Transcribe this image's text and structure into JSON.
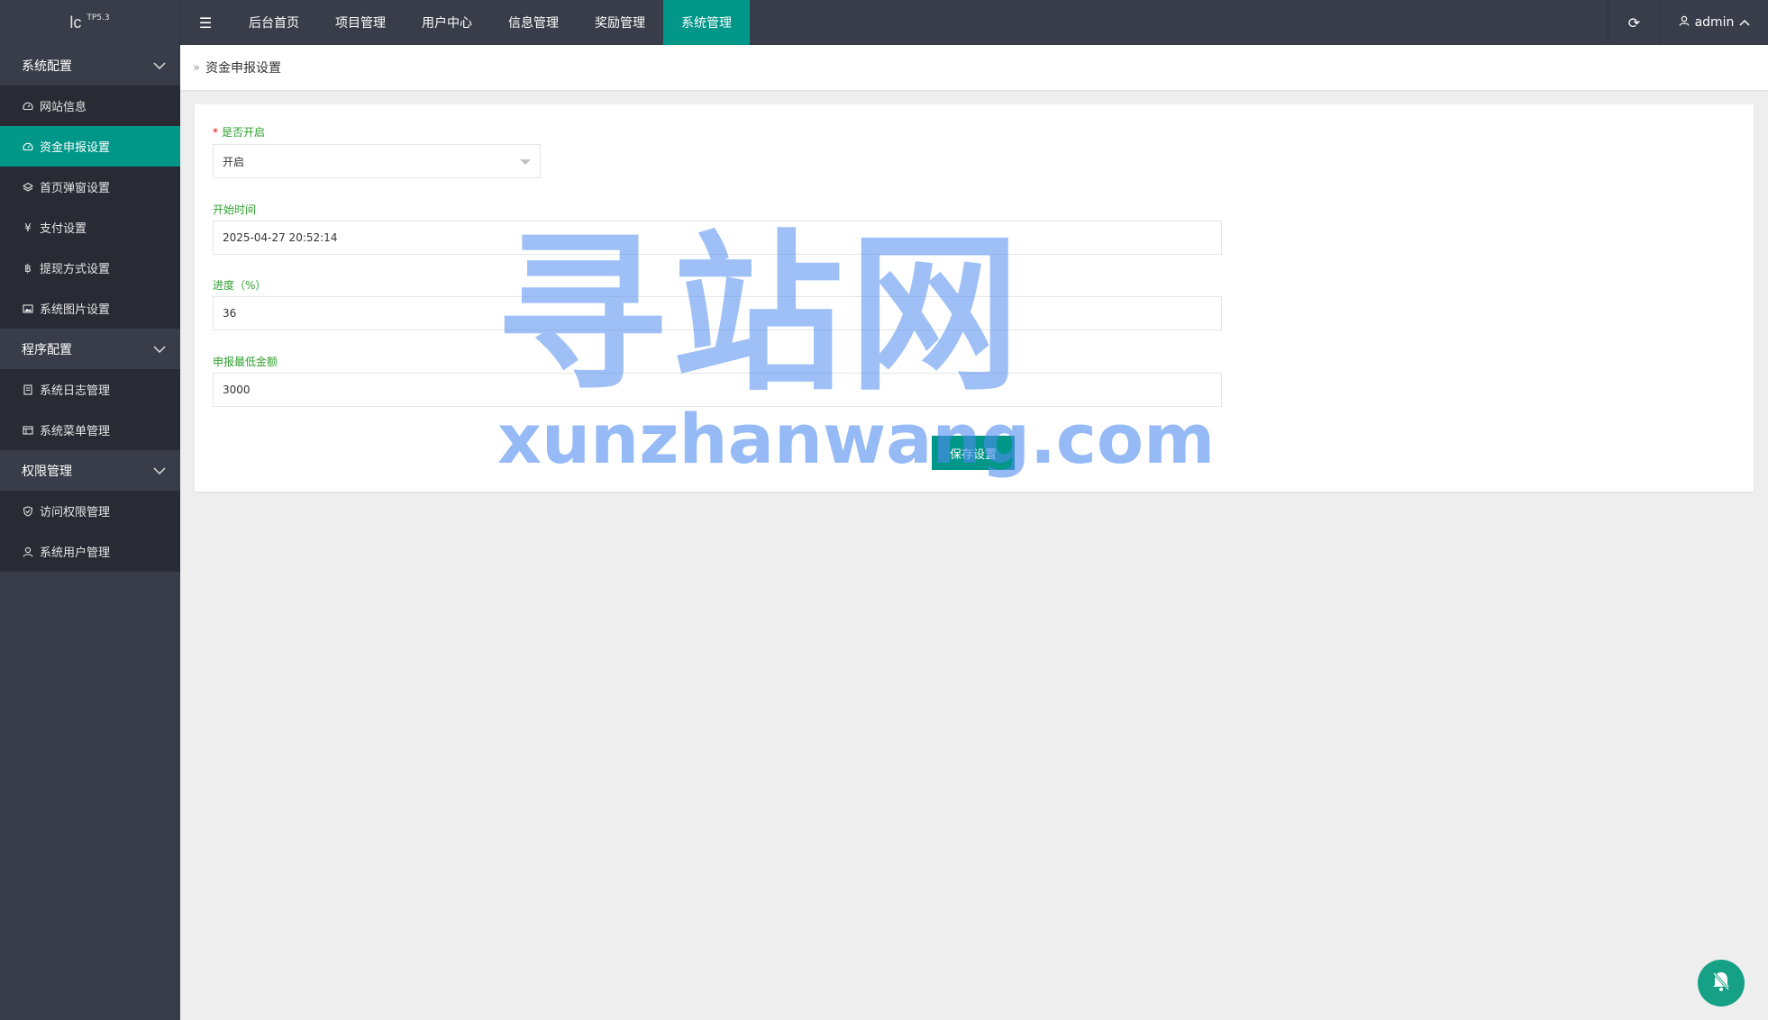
{
  "logo": {
    "main": "lc",
    "sup": "TP5.3"
  },
  "topnav": {
    "toggle_icon": "menu-icon",
    "items": [
      "后台首页",
      "项目管理",
      "用户中心",
      "信息管理",
      "奖励管理",
      "系统管理"
    ],
    "active_index": 5
  },
  "user": {
    "name": "admin"
  },
  "sidebar": {
    "groups": [
      {
        "label": "系统配置",
        "items": [
          {
            "label": "网站信息",
            "icon": "dashboard-icon"
          },
          {
            "label": "资金申报设置",
            "icon": "dashboard-icon",
            "active": true
          },
          {
            "label": "首页弹窗设置",
            "icon": "layers-icon"
          },
          {
            "label": "支付设置",
            "icon": "yen-icon"
          },
          {
            "label": "提现方式设置",
            "icon": "bitcoin-icon"
          },
          {
            "label": "系统图片设置",
            "icon": "image-icon"
          }
        ]
      },
      {
        "label": "程序配置",
        "items": [
          {
            "label": "系统日志管理",
            "icon": "log-icon"
          },
          {
            "label": "系统菜单管理",
            "icon": "menu-table-icon"
          }
        ]
      },
      {
        "label": "权限管理",
        "items": [
          {
            "label": "访问权限管理",
            "icon": "shield-icon"
          },
          {
            "label": "系统用户管理",
            "icon": "user-icon"
          }
        ]
      }
    ]
  },
  "breadcrumb": {
    "current": "资金申报设置"
  },
  "form": {
    "enabled": {
      "label": "是否开启",
      "required": "*",
      "value": "开启"
    },
    "start_time": {
      "label": "开始时间",
      "value": "2025-04-27 20:52:14"
    },
    "progress": {
      "label": "进度（%）",
      "value": "36"
    },
    "min_amount": {
      "label": "申报最低金额",
      "value": "3000"
    },
    "save_label": "保存设置"
  },
  "watermark": {
    "cn": "寻站网",
    "en": "xunzhanwang.com"
  },
  "colors": {
    "header": "#393d49",
    "accent": "#009688",
    "sidebar_item": "#282b33",
    "label": "#2ea12e"
  }
}
